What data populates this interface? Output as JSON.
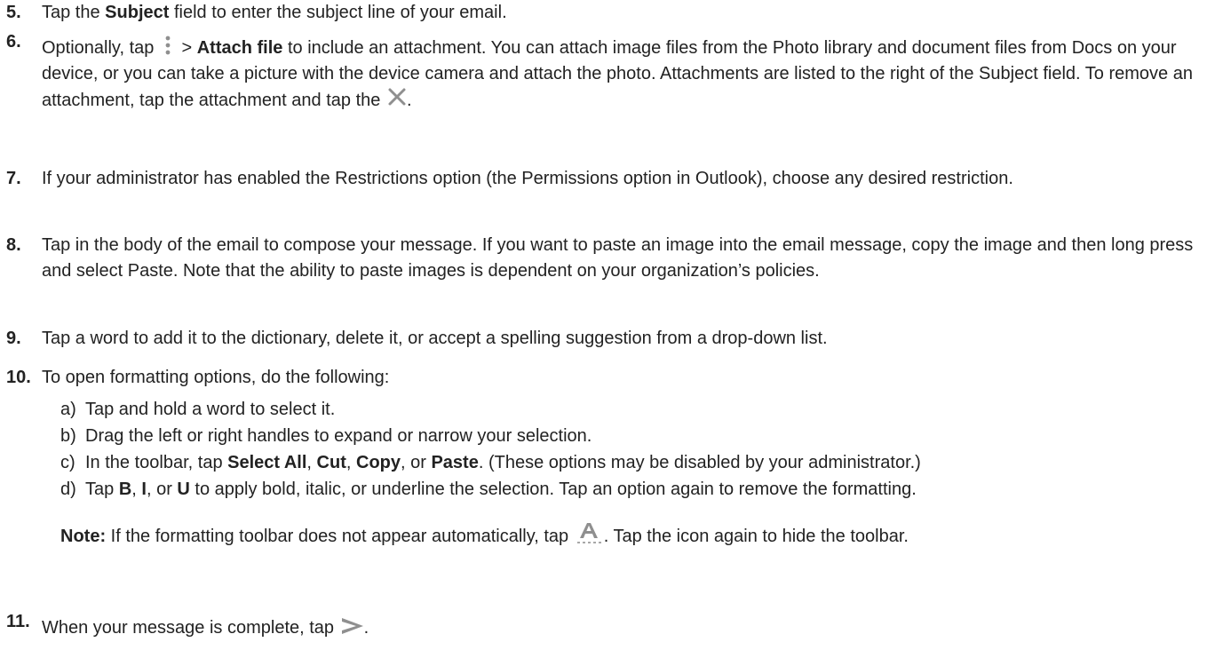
{
  "steps": {
    "s5": {
      "num": "5.",
      "t1": "Tap the ",
      "b1": "Subject",
      "t2": " field to enter the subject line of your email."
    },
    "s6": {
      "num": "6.",
      "t1": "Optionally, tap ",
      "t2": " > ",
      "b1": "Attach file",
      "t3": " to include an attachment. You can attach image files from the Photo library and document files from Docs on your device, or you can take a picture with the device camera and attach the photo. Attachments are listed to the right of the Subject field. To remove an attachment, tap the attachment and tap the ",
      "t4": "."
    },
    "s7": {
      "num": "7.",
      "t1": "If your administrator has enabled the Restrictions option (the Permissions option in Outlook), choose any desired restriction."
    },
    "s8": {
      "num": "8.",
      "t1": "Tap in the body of the email to compose your message. If you want to paste an image into the email message, copy the image and then long press and select Paste. Note that the ability to paste images is dependent on your organization’s policies."
    },
    "s9": {
      "num": "9.",
      "t1": "Tap a word to add it to the dictionary, delete it, or accept a spelling suggestion from a drop-down list."
    },
    "s10": {
      "num": "10.",
      "t1": "To open formatting options, do the following:",
      "a": {
        "mark": "a)",
        "t1": "Tap and hold a word to select it."
      },
      "b": {
        "mark": "b)",
        "t1": "Drag the left or right handles to expand or narrow your selection."
      },
      "c": {
        "mark": "c)",
        "t1": "In the toolbar, tap ",
        "b1": "Select All",
        "t2": ", ",
        "b2": "Cut",
        "t3": ", ",
        "b3": "Copy",
        "t4": ", or ",
        "b4": "Paste",
        "t5": ". (These options may be disabled by your administrator.)"
      },
      "d": {
        "mark": "d)",
        "t1": "Tap ",
        "b1": "B",
        "t2": ", ",
        "b2": "I",
        "t3": ", or ",
        "b3": "U",
        "t4": " to apply bold, italic, or underline the selection. Tap an option again to remove the formatting."
      },
      "note": {
        "label": "Note:",
        "t1": " If the formatting toolbar does not appear automatically, tap ",
        "t2": ". Tap the icon again to hide the toolbar."
      }
    },
    "s11": {
      "num": "11.",
      "t1": "When your message is complete, tap ",
      "t2": "."
    }
  },
  "icons": {
    "more": "more-vertical-icon",
    "close": "close-x-icon",
    "format": "text-format-icon",
    "send": "send-icon"
  },
  "colors": {
    "text": "#222222",
    "icon": "#8f8f8f",
    "icon_light": "#a8a8a8"
  }
}
